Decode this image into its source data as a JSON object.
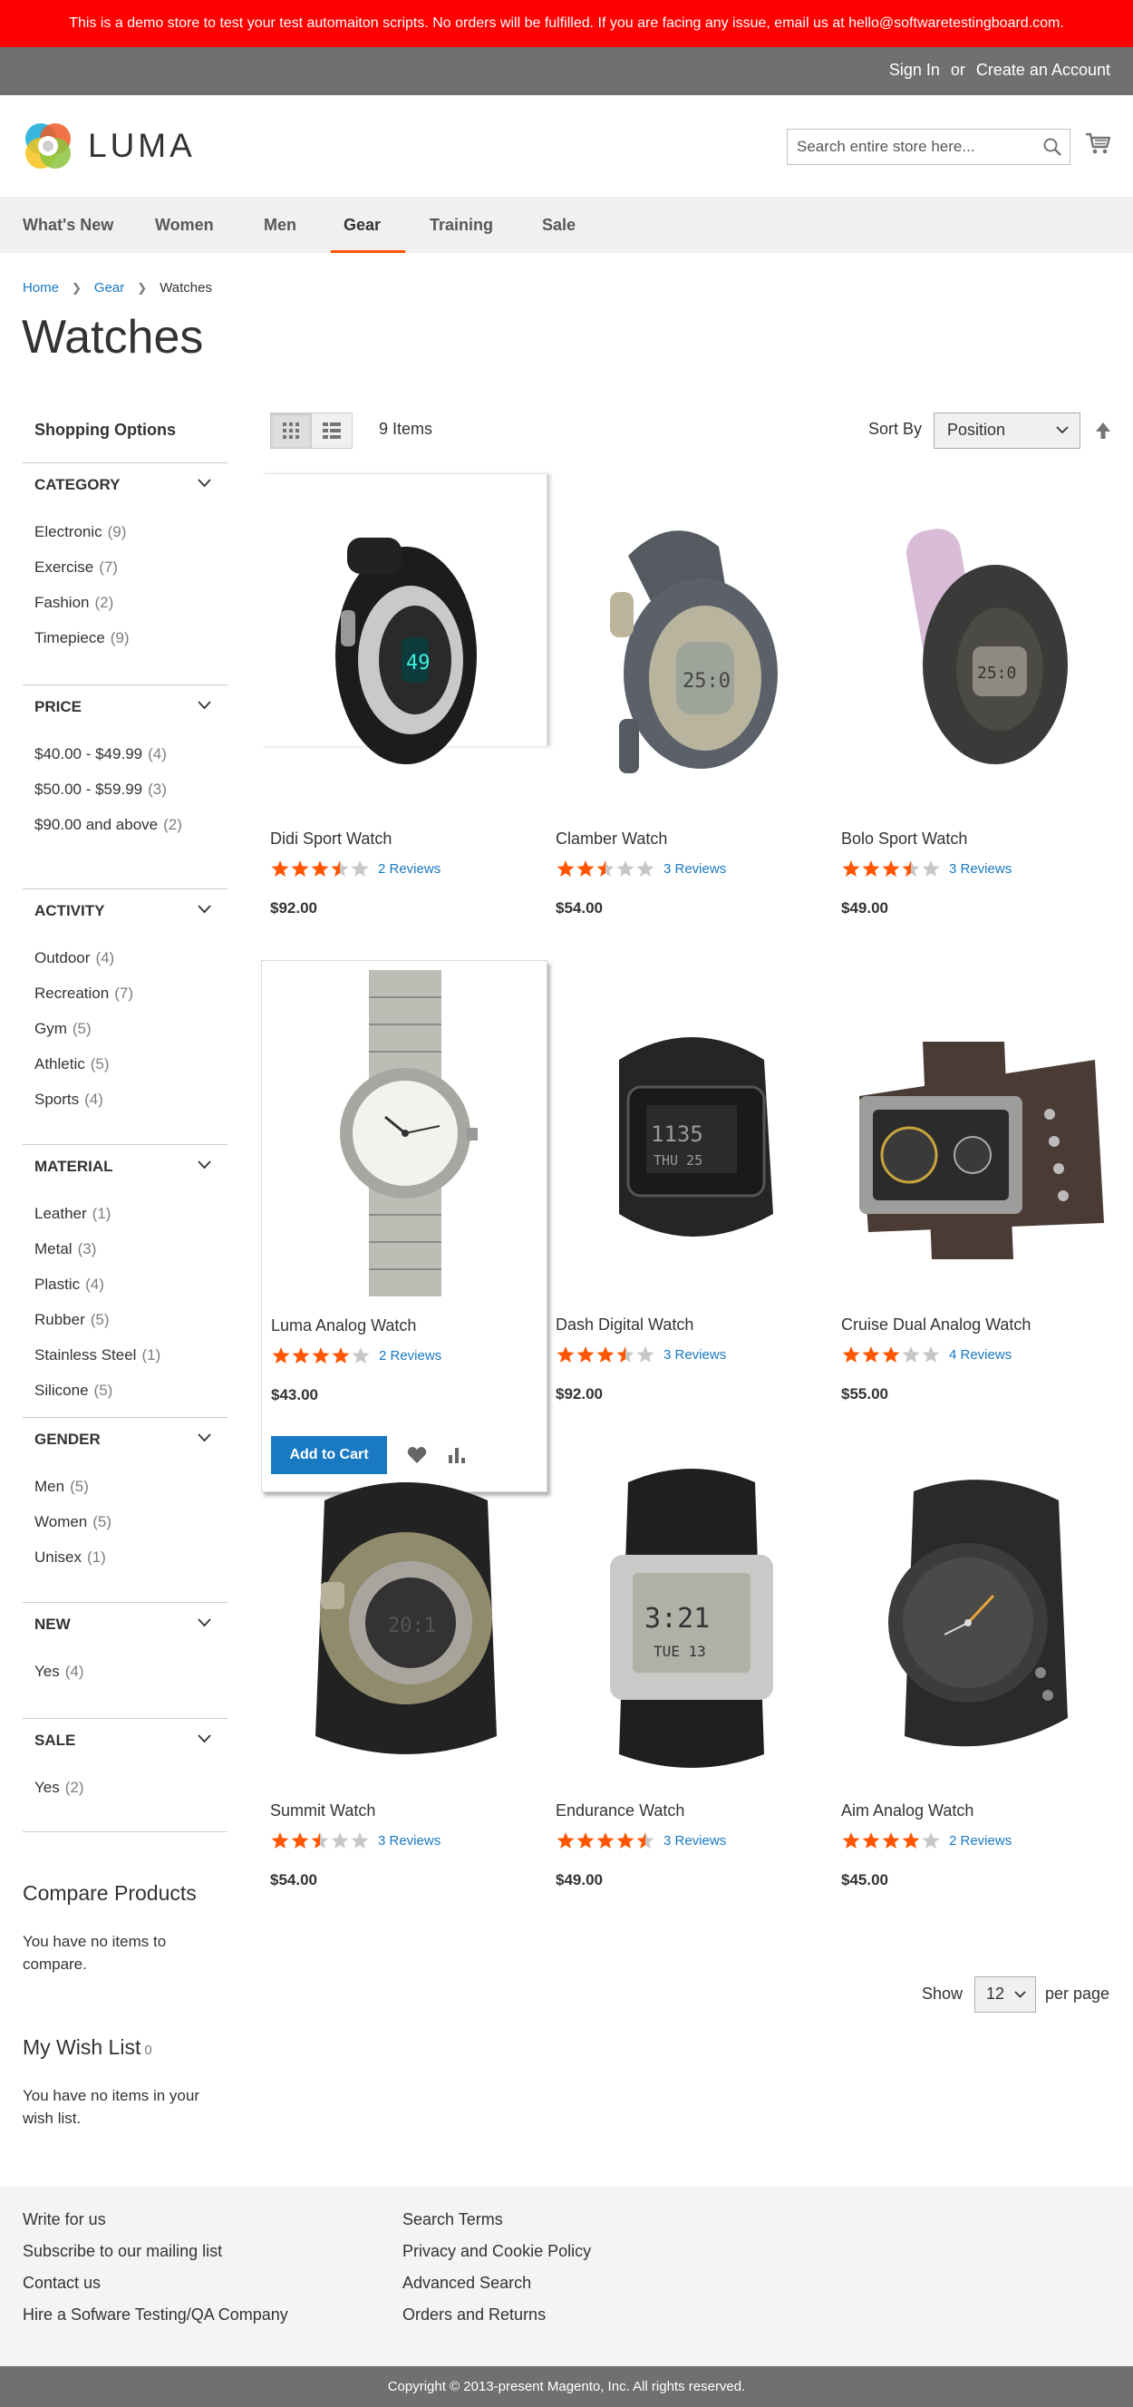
{
  "demo_notice": "This is a demo store to test your test automaiton scripts. No orders will be fulfilled. If you are facing any issue, email us at hello@softwaretestingboard.com.",
  "header": {
    "sign_in": "Sign In",
    "or": "or",
    "create_account": "Create an Account",
    "logo_text": "LUMA",
    "search_placeholder": "Search entire store here...",
    "cart_icon": "cart-icon",
    "search_icon": "search-icon"
  },
  "nav": [
    "What's New",
    "Women",
    "Men",
    "Gear",
    "Training",
    "Sale"
  ],
  "nav_active": "Gear",
  "breadcrumb": [
    "Home",
    "Gear",
    "Watches"
  ],
  "page_title": "Watches",
  "sidebar": {
    "shopping_options": "Shopping Options",
    "filters": [
      {
        "title": "CATEGORY",
        "options": [
          {
            "label": "Electronic",
            "count": "9"
          },
          {
            "label": "Exercise",
            "count": "7"
          },
          {
            "label": "Fashion",
            "count": "2"
          },
          {
            "label": "Timepiece",
            "count": "9"
          }
        ]
      },
      {
        "title": "PRICE",
        "options": [
          {
            "label": "$40.00 - $49.99",
            "count": "4"
          },
          {
            "label": "$50.00 - $59.99",
            "count": "3"
          },
          {
            "label": "$90.00 and above",
            "count": "2"
          }
        ]
      },
      {
        "title": "ACTIVITY",
        "options": [
          {
            "label": "Outdoor",
            "count": "4"
          },
          {
            "label": "Recreation",
            "count": "7"
          },
          {
            "label": "Gym",
            "count": "5"
          },
          {
            "label": "Athletic",
            "count": "5"
          },
          {
            "label": "Sports",
            "count": "4"
          }
        ]
      },
      {
        "title": "MATERIAL",
        "options": [
          {
            "label": "Leather",
            "count": "1"
          },
          {
            "label": "Metal",
            "count": "3"
          },
          {
            "label": "Plastic",
            "count": "4"
          },
          {
            "label": "Rubber",
            "count": "5"
          },
          {
            "label": "Stainless Steel",
            "count": "1"
          },
          {
            "label": "Silicone",
            "count": "5"
          }
        ]
      },
      {
        "title": "GENDER",
        "options": [
          {
            "label": "Men",
            "count": "5"
          },
          {
            "label": "Women",
            "count": "5"
          },
          {
            "label": "Unisex",
            "count": "1"
          }
        ]
      },
      {
        "title": "NEW",
        "options": [
          {
            "label": "Yes",
            "count": "4"
          }
        ]
      },
      {
        "title": "SALE",
        "options": [
          {
            "label": "Yes",
            "count": "2"
          }
        ]
      }
    ],
    "compare_title": "Compare Products",
    "compare_empty": "You have no items to compare.",
    "wishlist_title": "My Wish List",
    "wishlist_count": "0",
    "wishlist_empty": "You have no items in your wish list."
  },
  "toolbar": {
    "items_count": "9 Items",
    "sort_label": "Sort By",
    "sort_value": "Position",
    "show_label": "Show",
    "limit_value": "12",
    "per_page": "per page"
  },
  "products": [
    {
      "name": "Didi Sport Watch",
      "reviews": "2 Reviews",
      "price": "$92.00",
      "rating": 3.5
    },
    {
      "name": "Clamber Watch",
      "reviews": "3 Reviews",
      "price": "$54.00",
      "rating": 2.5
    },
    {
      "name": "Bolo Sport Watch",
      "reviews": "3 Reviews",
      "price": "$49.00",
      "rating": 3.5
    },
    {
      "name": "Luma Analog Watch",
      "reviews": "2 Reviews",
      "price": "$43.00",
      "rating": 4
    },
    {
      "name": "Dash Digital Watch",
      "reviews": "3 Reviews",
      "price": "$92.00",
      "rating": 3.5
    },
    {
      "name": "Cruise Dual Analog Watch",
      "reviews": "4 Reviews",
      "price": "$55.00",
      "rating": 3
    },
    {
      "name": "Summit Watch",
      "reviews": "3 Reviews",
      "price": "$54.00",
      "rating": 2.5
    },
    {
      "name": "Endurance Watch",
      "reviews": "3 Reviews",
      "price": "$49.00",
      "rating": 4.5
    },
    {
      "name": "Aim Analog Watch",
      "reviews": "2 Reviews",
      "price": "$45.00",
      "rating": 4
    }
  ],
  "hover_actions": {
    "add_to_cart": "Add to Cart",
    "wishlist_icon": "heart-icon",
    "compare_icon": "compare-icon"
  },
  "footer": {
    "col1": [
      "Write for us",
      "Subscribe to our mailing list",
      "Contact us",
      "Hire a Sofware Testing/QA Company"
    ],
    "col2": [
      "Search Terms",
      "Privacy and Cookie Policy",
      "Advanced Search",
      "Orders and Returns"
    ],
    "copyright": "Copyright © 2013-present Magento, Inc. All rights reserved."
  },
  "colors": {
    "accent": "#1979c3",
    "star": "#ff5501",
    "demo_bar": "#ff0101",
    "top_bar": "#6e716e"
  }
}
